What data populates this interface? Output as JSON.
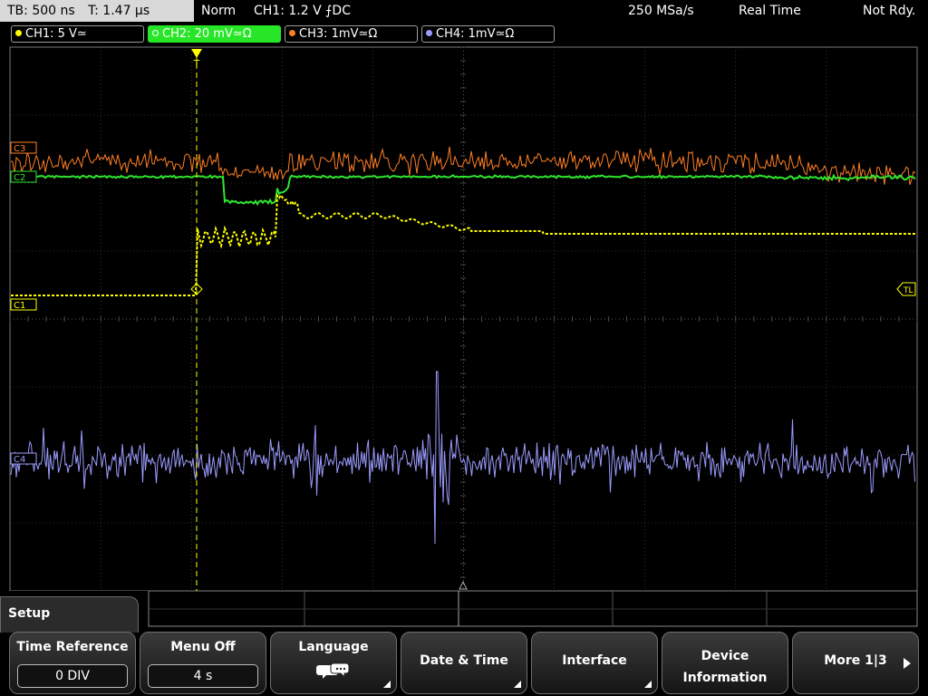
{
  "topbar": {
    "timebase": "TB: 500 ns",
    "trigger_time": "T: 1.47 µs",
    "mode": "Norm",
    "trigger": "CH1: 1.2 V ⨍DC",
    "sample_rate": "250 MSa/s",
    "acquisition": "Real Time",
    "status": "Not Rdy."
  },
  "channels": [
    {
      "label": "CH1: 5 V≃",
      "color": "#ffff00"
    },
    {
      "label": "CH2: 20 mV≃Ω",
      "color": "#2fe62f"
    },
    {
      "label": "CH3: 1mV≃Ω",
      "color": "#ff7f24"
    },
    {
      "label": "CH4: 1mV≃Ω",
      "color": "#9b9bff"
    }
  ],
  "markers": {
    "ch3": "C3",
    "ch2": "C2",
    "ch1": "C1",
    "ch4": "C4",
    "trigger_level": "TL",
    "trigger_position": "T"
  },
  "colors": {
    "ch1": "#ffff00",
    "ch2": "#2fe62f",
    "ch3": "#ff7f24",
    "ch4": "#9b9bff",
    "grid": "#5a5a5a",
    "trigger": "#ffff00"
  },
  "menu": {
    "title": "Setup",
    "softkeys": [
      {
        "label": "Time Reference",
        "value": "0 DIV"
      },
      {
        "label": "Menu Off",
        "value": "4 s"
      },
      {
        "label": "Language",
        "icon": "speech-bubbles-icon"
      },
      {
        "label": "Date & Time"
      },
      {
        "label": "Interface"
      },
      {
        "label_line1": "Device",
        "label_line2": "Information"
      },
      {
        "label": "More 1|3"
      }
    ]
  }
}
